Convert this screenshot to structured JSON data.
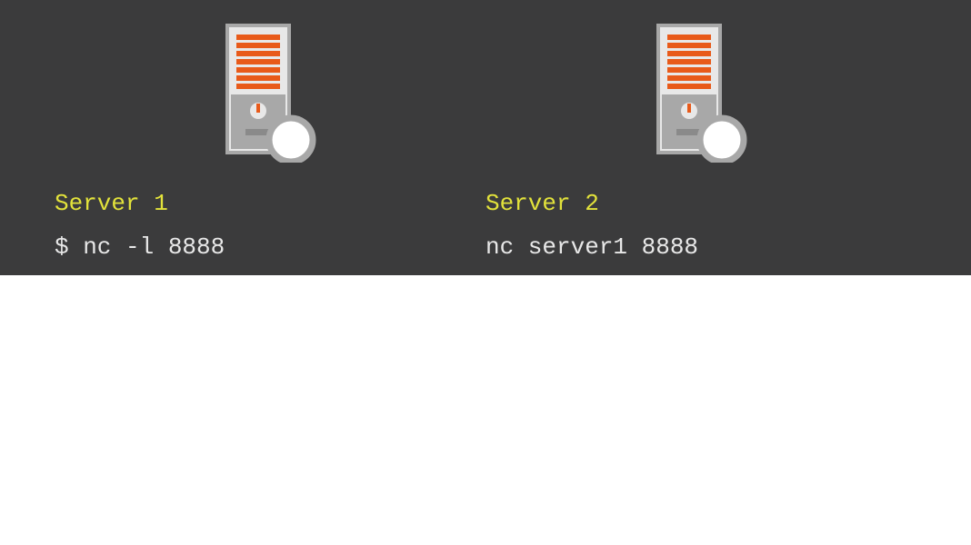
{
  "servers": [
    {
      "title": "Server 1",
      "command": "$ nc -l 8888"
    },
    {
      "title": "Server 2",
      "command": "nc server1 8888"
    }
  ],
  "colors": {
    "background": "#3b3b3c",
    "title": "#e2e23b",
    "command": "#e8e8e8",
    "server_orange": "#e85a1a",
    "server_gray": "#a8a8a8",
    "server_light": "#e8e8e8"
  }
}
